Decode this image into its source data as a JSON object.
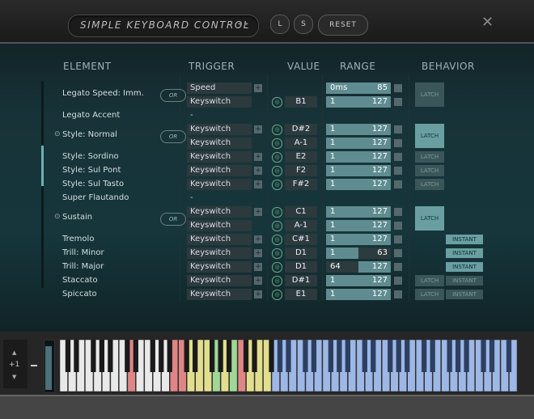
{
  "header": {
    "title": "SIMPLE KEYBOARD CONTROL",
    "l_label": "L",
    "s_label": "S",
    "reset_label": "RESET",
    "close_glyph": "✕"
  },
  "columns": {
    "element": "ELEMENT",
    "trigger": "TRIGGER",
    "value": "VALUE",
    "range": "RANGE",
    "behavior": "BEHAVIOR"
  },
  "rows": [
    {
      "element": "Legato Speed: Imm.",
      "trigger": "Speed",
      "value": "",
      "range_lo": "0ms",
      "range_hi": "85",
      "fill": [
        0,
        1
      ]
    },
    {
      "element": "",
      "trigger": "Keyswitch",
      "value": "B1",
      "range_lo": "1",
      "range_hi": "127",
      "fill": [
        0,
        1
      ]
    },
    {
      "element": "Legato Accent",
      "trigger": "-",
      "value": "",
      "range_lo": "",
      "range_hi": ""
    },
    {
      "element": "Style: Normal",
      "trigger": "Keyswitch",
      "value": "D#2",
      "range_lo": "1",
      "range_hi": "127",
      "fill": [
        0,
        1
      ]
    },
    {
      "element": "",
      "trigger": "Keyswitch",
      "value": "A-1",
      "range_lo": "1",
      "range_hi": "127",
      "fill": [
        0,
        1
      ]
    },
    {
      "element": "Style: Sordino",
      "trigger": "Keyswitch",
      "value": "E2",
      "range_lo": "1",
      "range_hi": "127",
      "fill": [
        0,
        1
      ]
    },
    {
      "element": "Style: Sul Pont",
      "trigger": "Keyswitch",
      "value": "F2",
      "range_lo": "1",
      "range_hi": "127",
      "fill": [
        0,
        1
      ]
    },
    {
      "element": "Style: Sul Tasto",
      "trigger": "Keyswitch",
      "value": "F#2",
      "range_lo": "1",
      "range_hi": "127",
      "fill": [
        0,
        1
      ]
    },
    {
      "element": "Super Flautando",
      "trigger": "-",
      "value": "",
      "range_lo": "",
      "range_hi": ""
    },
    {
      "element": "Sustain",
      "trigger": "Keyswitch",
      "value": "C1",
      "range_lo": "1",
      "range_hi": "127",
      "fill": [
        0,
        1
      ]
    },
    {
      "element": "",
      "trigger": "Keyswitch",
      "value": "A-1",
      "range_lo": "1",
      "range_hi": "127",
      "fill": [
        0,
        1
      ]
    },
    {
      "element": "Tremolo",
      "trigger": "Keyswitch",
      "value": "C#1",
      "range_lo": "1",
      "range_hi": "127",
      "fill": [
        0,
        1
      ]
    },
    {
      "element": "Trill: Minor",
      "trigger": "Keyswitch",
      "value": "D1",
      "range_lo": "1",
      "range_hi": "63",
      "fill": [
        0,
        0.5
      ]
    },
    {
      "element": "Trill: Major",
      "trigger": "Keyswitch",
      "value": "D1",
      "range_lo": "64",
      "range_hi": "127",
      "fill": [
        0.5,
        1
      ]
    },
    {
      "element": "Staccato",
      "trigger": "Keyswitch",
      "value": "D#1",
      "range_lo": "1",
      "range_hi": "127",
      "fill": [
        0,
        1
      ]
    },
    {
      "element": "Spiccato",
      "trigger": "Keyswitch",
      "value": "E1",
      "range_lo": "1",
      "range_hi": "127",
      "fill": [
        0,
        1
      ]
    }
  ],
  "or_label": "OR",
  "behavior": {
    "latch": "LATCH",
    "instant": "INSTANT"
  },
  "octave": {
    "label": "+1",
    "up": "▲",
    "down": "▼"
  },
  "colors": {
    "key_red": "#e08585",
    "key_yellow": "#e3de8e",
    "key_green": "#9fd896",
    "key_blue": "#9db7e6",
    "key_white": "#e9e9e9"
  }
}
